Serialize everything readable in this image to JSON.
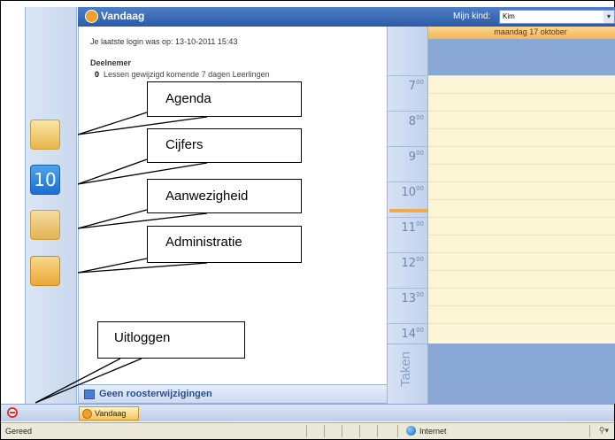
{
  "header": {
    "title": "Vandaag",
    "kid_label": "Mijn kind:",
    "kid_value": "Kim"
  },
  "sidebar": {
    "icons": [
      {
        "name": "agenda-icon"
      },
      {
        "name": "cijfers-icon",
        "text": "10"
      },
      {
        "name": "aanwezigheid-icon"
      },
      {
        "name": "administratie-icon"
      }
    ]
  },
  "info": {
    "last_login": "Je laatste login was op: 13-10-2011 15:43",
    "section_title": "Deelnemer",
    "item_count": "0",
    "item_text": "Lessen gewijzigd komende 7 dagen Leerlingen"
  },
  "footer_panel": {
    "label": "Geen roosterwijzigingen"
  },
  "calendar": {
    "day_header": "maandag 17 oktober",
    "hours": [
      "7",
      "8",
      "9",
      "10",
      "11",
      "12",
      "13",
      "14"
    ],
    "minutes": "00",
    "tasks_label": "Taken"
  },
  "taskbar": {
    "tab_label": "Vandaag"
  },
  "statusbar": {
    "status": "Gereed",
    "zone": "Internet"
  },
  "callouts": {
    "agenda": "Agenda",
    "cijfers": "Cijfers",
    "aanwezigheid": "Aanwezigheid",
    "administratie": "Administratie",
    "uitloggen": "Uitloggen"
  },
  "colors": {
    "header_blue": "#2c5aa6",
    "calendar_yellow": "#fdf6d6",
    "day_header_orange": "#f4b458",
    "logout_red": "#e03030"
  }
}
